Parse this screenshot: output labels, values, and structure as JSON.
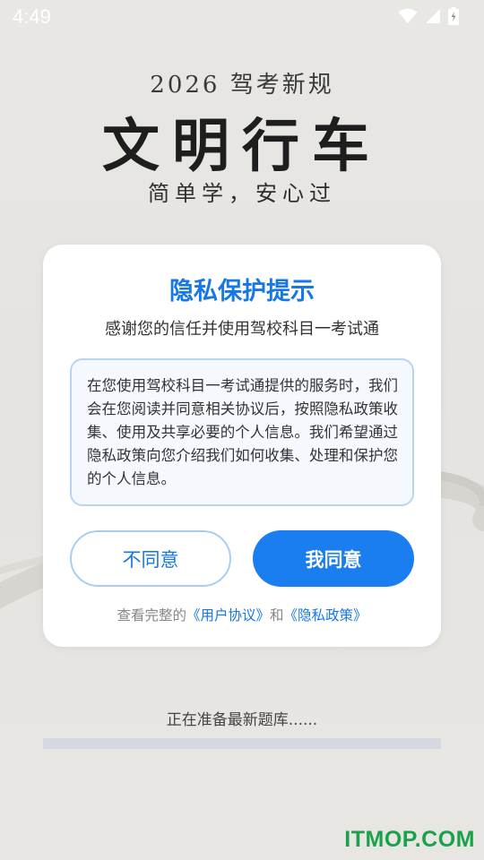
{
  "status_bar": {
    "time": "4:49",
    "icons": [
      "wifi-icon",
      "signal-icon",
      "battery-charging-icon"
    ]
  },
  "splash": {
    "year_line": "2026 驾考新规",
    "title": "文明行车",
    "slogan": "简单学，安心过"
  },
  "dialog": {
    "title": "隐私保护提示",
    "subtitle": "感谢您的信任并使用驾校科目一考试通",
    "body": "在您使用驾校科目一考试通提供的服务时，我们会在您阅读并同意相关协议后，按照隐私政策收集、使用及共享必要的个人信息。我们希望通过隐私政策向您介绍我们如何收集、处理和保护您的个人信息。",
    "disagree_label": "不同意",
    "agree_label": "我同意",
    "footer_prefix": "查看完整的",
    "user_agreement_link": "《用户协议》",
    "footer_and": "和",
    "privacy_policy_link": "《隐私政策》"
  },
  "loading": {
    "text": "正在准备最新题库......",
    "progress": 0.0
  },
  "watermark": "ITMOP.COM",
  "colors": {
    "accent": "#1677e5",
    "agree_button": "#1a7ef0",
    "box_border": "#b9d4f2",
    "watermark": "#1aa24a"
  }
}
